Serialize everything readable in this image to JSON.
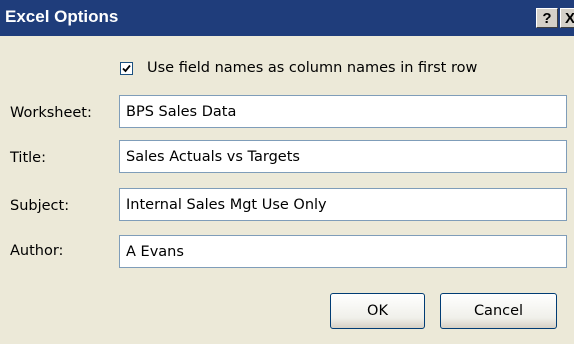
{
  "window": {
    "title": "Excel Options",
    "help_label": "?",
    "close_label": "X"
  },
  "options": {
    "use_field_names": {
      "label": "Use field names as column names in first row",
      "checked": true
    }
  },
  "fields": {
    "worksheet": {
      "label": "Worksheet:",
      "value": "BPS Sales Data"
    },
    "title": {
      "label": "Title:",
      "value": "Sales Actuals vs Targets"
    },
    "subject": {
      "label": "Subject:",
      "value": "Internal Sales Mgt Use Only"
    },
    "author": {
      "label": "Author:",
      "value": "A Evans"
    }
  },
  "buttons": {
    "ok_label": "OK",
    "cancel_label": "Cancel"
  },
  "colors": {
    "titlebar": "#1F3D7B",
    "dialog_background": "#ECE9D8",
    "input_border": "#7F9DB9"
  }
}
